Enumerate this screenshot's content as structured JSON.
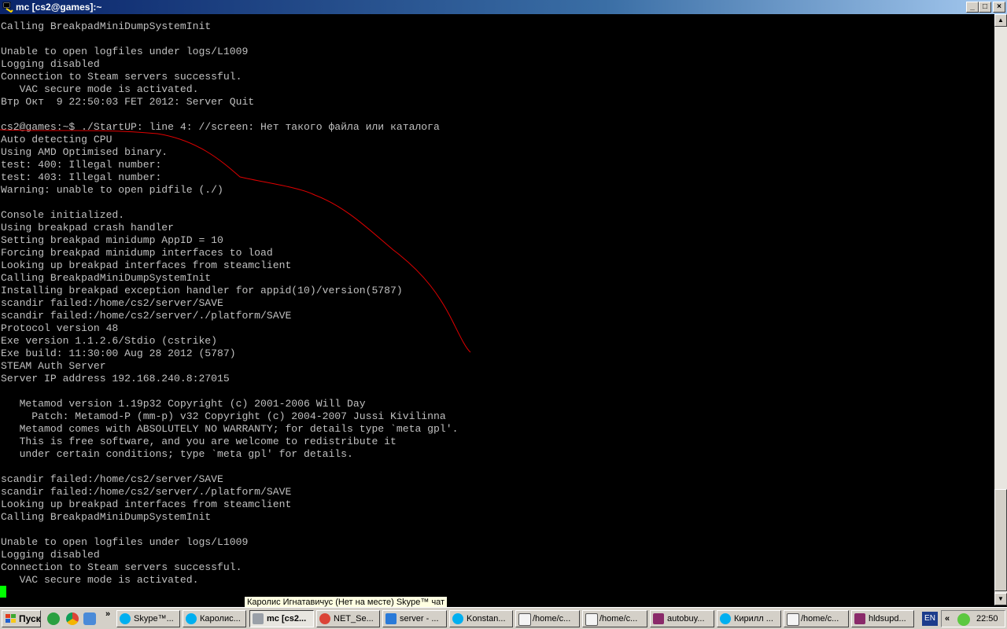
{
  "window": {
    "title": "mc [cs2@games]:~",
    "buttons": {
      "minimize": "_",
      "maximize": "□",
      "close": "×"
    }
  },
  "terminal": {
    "lines": [
      "Calling BreakpadMiniDumpSystemInit",
      "",
      "Unable to open logfiles under logs/L1009",
      "Logging disabled",
      "Connection to Steam servers successful.",
      "   VAC secure mode is activated.",
      "Втр Окт  9 22:50:03 FET 2012: Server Quit",
      "",
      "cs2@games:~$ ./StartUP: line 4: //screen: Нет такого файла или каталога",
      "Auto detecting CPU",
      "Using AMD Optimised binary.",
      "test: 400: Illegal number:",
      "test: 403: Illegal number:",
      "Warning: unable to open pidfile (./)",
      "",
      "Console initialized.",
      "Using breakpad crash handler",
      "Setting breakpad minidump AppID = 10",
      "Forcing breakpad minidump interfaces to load",
      "Looking up breakpad interfaces from steamclient",
      "Calling BreakpadMiniDumpSystemInit",
      "Installing breakpad exception handler for appid(10)/version(5787)",
      "scandir failed:/home/cs2/server/SAVE",
      "scandir failed:/home/cs2/server/./platform/SAVE",
      "Protocol version 48",
      "Exe version 1.1.2.6/Stdio (cstrike)",
      "Exe build: 11:30:00 Aug 28 2012 (5787)",
      "STEAM Auth Server",
      "Server IP address 192.168.240.8:27015",
      "",
      "   Metamod version 1.19p32 Copyright (c) 2001-2006 Will Day",
      "     Patch: Metamod-P (mm-p) v32 Copyright (c) 2004-2007 Jussi Kivilinna",
      "   Metamod comes with ABSOLUTELY NO WARRANTY; for details type `meta gpl'.",
      "   This is free software, and you are welcome to redistribute it",
      "   under certain conditions; type `meta gpl' for details.",
      "",
      "scandir failed:/home/cs2/server/SAVE",
      "scandir failed:/home/cs2/server/./platform/SAVE",
      "Looking up breakpad interfaces from steamclient",
      "Calling BreakpadMiniDumpSystemInit",
      "",
      "Unable to open logfiles under logs/L1009",
      "Logging disabled",
      "Connection to Steam servers successful.",
      "   VAC secure mode is activated."
    ],
    "text_color": "#c0c0c0",
    "cursor_color": "#00ff00",
    "annotation_color": "#e00000"
  },
  "tooltip": "Каролис Игнатавичус (Нет на месте) Skype™ чат",
  "taskbar": {
    "start_label": "Пуск",
    "overflow": "»",
    "tasks": [
      {
        "label": "Skype™...",
        "icon": "skype-icon",
        "active": false
      },
      {
        "label": "Каролис...",
        "icon": "skype-chat-icon",
        "active": false
      },
      {
        "label": "mc [cs2...",
        "icon": "putty-icon",
        "active": true
      },
      {
        "label": "NET_Se...",
        "icon": "chrome-icon",
        "active": false
      },
      {
        "label": "server - ...",
        "icon": "winscp-icon",
        "active": false
      },
      {
        "label": "Konstan...",
        "icon": "skype-chat-icon",
        "active": false
      },
      {
        "label": "/home/c...",
        "icon": "editor-icon",
        "active": false
      },
      {
        "label": "/home/c...",
        "icon": "editor-icon",
        "active": false
      },
      {
        "label": "autobuy...",
        "icon": "winrar-icon",
        "active": false
      },
      {
        "label": "Кирилл ...",
        "icon": "skype-chat-icon",
        "active": false
      },
      {
        "label": "/home/c...",
        "icon": "editor-icon",
        "active": false
      },
      {
        "label": "hldsupd...",
        "icon": "winrar-icon",
        "active": false
      }
    ],
    "language": "EN",
    "tray_expand": "«",
    "clock": "22:50"
  }
}
